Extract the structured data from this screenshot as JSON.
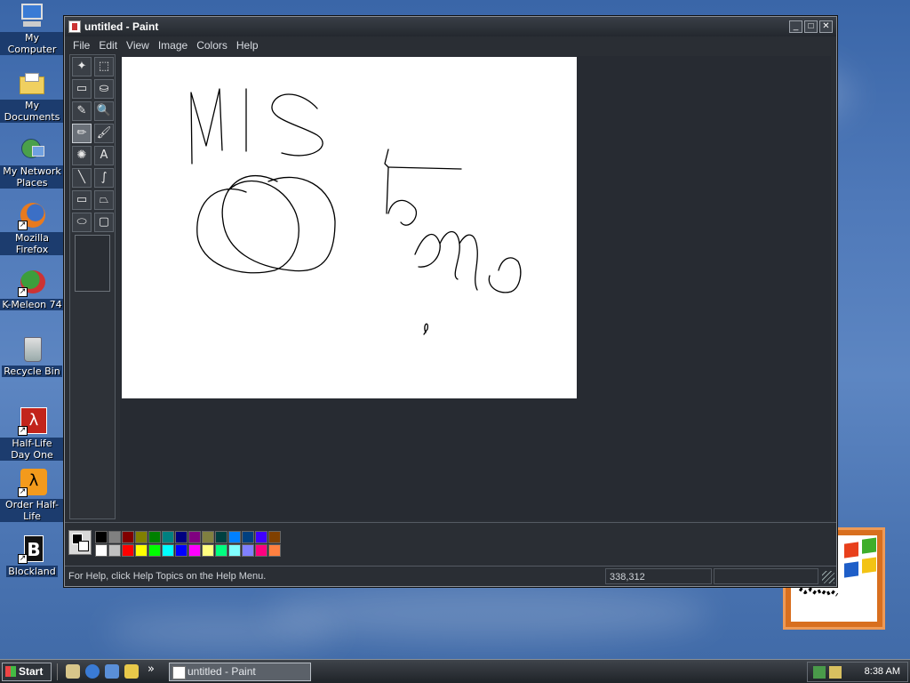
{
  "desktop": {
    "icons": [
      {
        "label": "My Computer"
      },
      {
        "label": "My Documents"
      },
      {
        "label": "My Network Places"
      },
      {
        "label": "Mozilla Firefox"
      },
      {
        "label": "K-Meleon 74"
      },
      {
        "label": "Recycle Bin"
      },
      {
        "label": "Half-Life Day One"
      },
      {
        "label": "Order Half-Life"
      },
      {
        "label": "Blockland"
      }
    ]
  },
  "window": {
    "title": "untitled - Paint",
    "controls": {
      "minimize": "_",
      "maximize": "□",
      "close": "✕"
    },
    "menu": [
      "File",
      "Edit",
      "View",
      "Image",
      "Colors",
      "Help"
    ],
    "tools": [
      {
        "name": "free-form-select",
        "glyph": "✦"
      },
      {
        "name": "rect-select",
        "glyph": "⬚"
      },
      {
        "name": "eraser",
        "glyph": "▭"
      },
      {
        "name": "fill",
        "glyph": "⛀"
      },
      {
        "name": "pick-color",
        "glyph": "✎"
      },
      {
        "name": "magnifier",
        "glyph": "🔍"
      },
      {
        "name": "pencil",
        "glyph": "✏"
      },
      {
        "name": "brush",
        "glyph": "🖌"
      },
      {
        "name": "airbrush",
        "glyph": "✺"
      },
      {
        "name": "text",
        "glyph": "A"
      },
      {
        "name": "line",
        "glyph": "╲"
      },
      {
        "name": "curve",
        "glyph": "∫"
      },
      {
        "name": "rectangle",
        "glyph": "▭"
      },
      {
        "name": "polygon",
        "glyph": "⏢"
      },
      {
        "name": "ellipse",
        "glyph": "⬭"
      },
      {
        "name": "rounded-rect",
        "glyph": "▢"
      }
    ],
    "selected_tool": "pencil",
    "canvas": {
      "text_drawn": "MIS tomo"
    },
    "palette": {
      "foreground": "#000000",
      "background": "#ffffff",
      "colors_top": [
        "#000000",
        "#808080",
        "#800000",
        "#808000",
        "#008000",
        "#008080",
        "#000080",
        "#800080",
        "#808040",
        "#004040",
        "#0080ff",
        "#004080",
        "#4000ff",
        "#804000"
      ],
      "colors_bottom": [
        "#ffffff",
        "#c0c0c0",
        "#ff0000",
        "#ffff00",
        "#00ff00",
        "#00ffff",
        "#0000ff",
        "#ff00ff",
        "#ffff80",
        "#00ff80",
        "#80ffff",
        "#8080ff",
        "#ff0080",
        "#ff8040"
      ]
    },
    "status": {
      "help_text": "For Help, click Help Topics on the Help Menu.",
      "coords": "338,312",
      "size": ""
    }
  },
  "taskbar": {
    "start_label": "Start",
    "quick_launch": [
      "show-desktop",
      "ie",
      "outlook",
      "explorer"
    ],
    "more_label": "»",
    "task": "untitled - Paint",
    "clock": "8:38 AM"
  }
}
